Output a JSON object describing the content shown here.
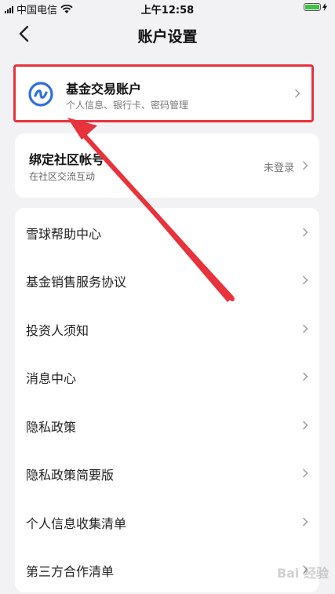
{
  "status_bar": {
    "carrier": "中国电信",
    "time": "上午12:58"
  },
  "header": {
    "title": "账户设置"
  },
  "fund_account": {
    "title": "基金交易账户",
    "subtitle": "个人信息、银行卡、密码管理"
  },
  "community": {
    "title": "绑定社区帐号",
    "subtitle": "在社区交流互动",
    "status": "未登录"
  },
  "menu": {
    "items": [
      {
        "label": "雪球帮助中心"
      },
      {
        "label": "基金销售服务协议"
      },
      {
        "label": "投资人须知"
      },
      {
        "label": "消息中心"
      },
      {
        "label": "隐私政策"
      },
      {
        "label": "隐私政策简要版"
      },
      {
        "label": "个人信息收集清单"
      },
      {
        "label": "第三方合作清单"
      }
    ]
  },
  "watermark": "Bai 经验",
  "colors": {
    "accent_blue": "#2f6fde",
    "highlight_red": "#e8323c"
  }
}
